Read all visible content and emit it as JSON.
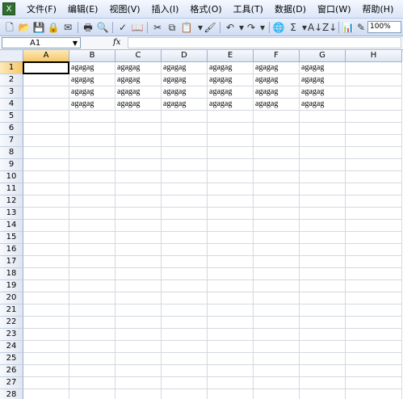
{
  "menubar": {
    "items": [
      "文件(F)",
      "编辑(E)",
      "视图(V)",
      "插入(I)",
      "格式(O)",
      "工具(T)",
      "数据(D)",
      "窗口(W)",
      "帮助(H)"
    ]
  },
  "toolbar": {
    "zoom": "100%"
  },
  "formula_bar": {
    "name_box": "A1",
    "fx_label": "fx",
    "formula": ""
  },
  "sheet": {
    "columns": [
      "A",
      "B",
      "C",
      "D",
      "E",
      "F",
      "G",
      "H"
    ],
    "rows": [
      "1",
      "2",
      "3",
      "4",
      "5",
      "6",
      "7",
      "8",
      "9",
      "10",
      "11",
      "12",
      "13",
      "14",
      "15",
      "16",
      "17",
      "18",
      "19",
      "20",
      "21",
      "22",
      "23",
      "24",
      "25",
      "26",
      "27",
      "28"
    ],
    "active_cell": "A1",
    "data": [
      [
        "",
        "agagag",
        "agagag",
        "agagag",
        "agagag",
        "agagag",
        "agagag",
        ""
      ],
      [
        "",
        "agagag",
        "agagag",
        "agagag",
        "agagag",
        "agagag",
        "agagag",
        ""
      ],
      [
        "",
        "agagag",
        "agagag",
        "agagag",
        "agagag",
        "agagag",
        "agagag",
        ""
      ],
      [
        "",
        "agagag",
        "agagag",
        "agagag",
        "agagag",
        "agagag",
        "agagag",
        ""
      ]
    ]
  }
}
